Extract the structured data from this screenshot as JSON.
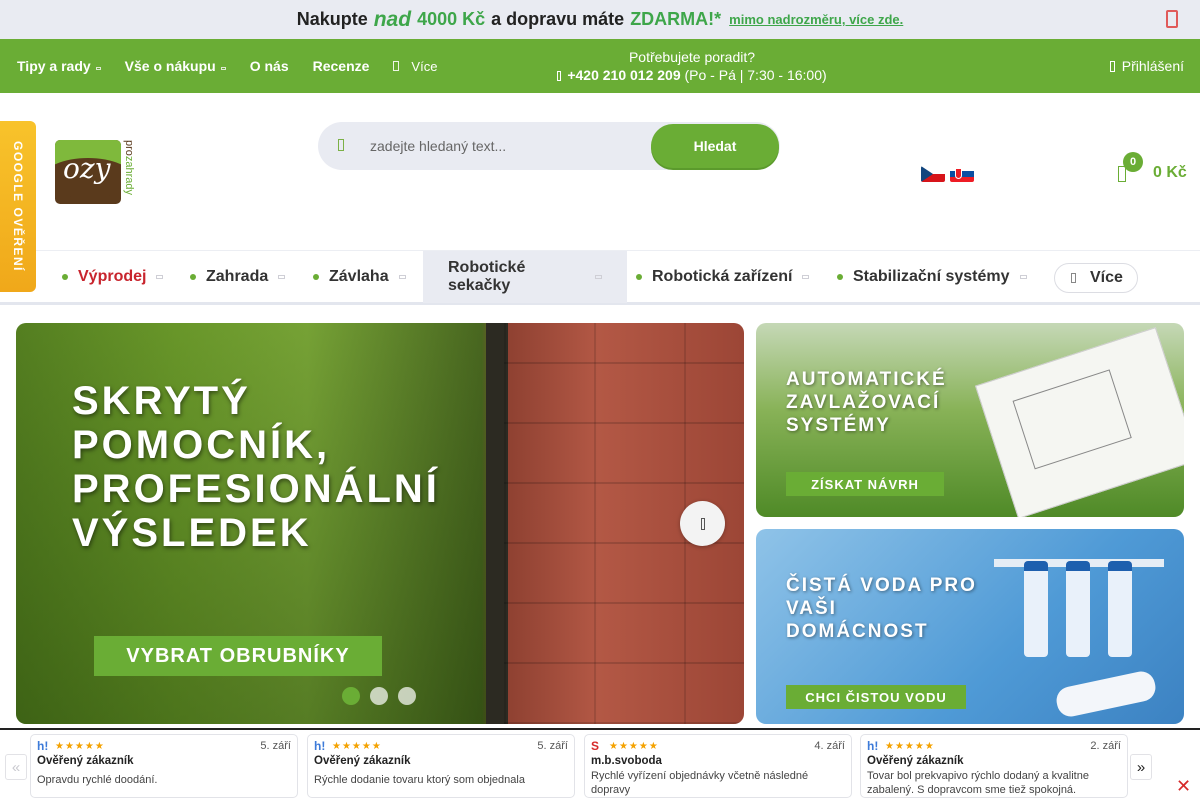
{
  "promo": {
    "text_a": "Nakupte",
    "text_nad": "nad",
    "amount": "4000 Kč",
    "text_b": "a dopravu máte",
    "free": "ZDARMA!*",
    "link": "mimo nadrozměru, více zde."
  },
  "topnav": {
    "items": [
      "Tipy a rady",
      "Vše o nákupu",
      "O nás",
      "Recenze"
    ],
    "more": "Více"
  },
  "help": {
    "title": "Potřebujete poradit?",
    "phone": "+420 210 012 209",
    "hours": "(Po - Pá | 7:30 - 16:00)"
  },
  "login": "Přihlášení",
  "google_tab": "GOOGLE OVĚŘENÍ",
  "logo": {
    "mark": "ozy",
    "text_a": "pro",
    "text_b": "zahrady"
  },
  "search": {
    "placeholder": "zadejte hledaný text...",
    "button": "Hledat"
  },
  "cart": {
    "count": "0",
    "total": "0 Kč"
  },
  "categories": [
    {
      "label": "Výprodej"
    },
    {
      "label": "Zahrada"
    },
    {
      "label": "Závlaha"
    },
    {
      "label": "Robotické sekačky"
    },
    {
      "label": "Robotická zařízení"
    },
    {
      "label": "Stabilizační systémy"
    }
  ],
  "categories_more": "Více",
  "colors": {
    "brand_green": "#6aad35",
    "sale_red": "#c8242d",
    "promo_bg": "#e9ebf2"
  },
  "main_banner": {
    "headline": "SKRYTÝ POMOCNÍK, PROFESIONÁLNÍ VÝSLEDEK",
    "cta": "VYBRAT OBRUBNÍKY",
    "slide_count": 3,
    "active_slide": 1
  },
  "side_banners": [
    {
      "title": "AUTOMATICKÉ ZAVLAŽOVACÍ SYSTÉMY",
      "cta": "ZÍSKAT NÁVRH"
    },
    {
      "title": "ČISTÁ VODA PRO VAŠI DOMÁCNOST",
      "cta": "CHCI ČISTOU VODU"
    }
  ],
  "reviews": {
    "prev": "«",
    "next": "»",
    "close": "✕",
    "items": [
      {
        "source": "h!",
        "stars": "★★★★★",
        "date": "5. září",
        "name": "Ověřený zákazník",
        "text": "Opravdu rychlé doodání."
      },
      {
        "source": "h!",
        "stars": "★★★★★",
        "date": "5. září",
        "name": "Ověřený zákazník",
        "text": "Rýchle dodanie tovaru ktorý som objednala"
      },
      {
        "source": "S",
        "stars": "★★★★★",
        "date": "4. září",
        "name": "m.b.svoboda",
        "text": "Rychlé vyřízení objednávky včetně následné dopravy"
      },
      {
        "source": "h!",
        "stars": "★★★★★",
        "date": "2. září",
        "name": "Ověřený zákazník",
        "text": "Tovar bol prekvapivo rýchlo dodaný a kvalitne zabalený. S dopravcom sme tiež spokojná."
      }
    ]
  }
}
